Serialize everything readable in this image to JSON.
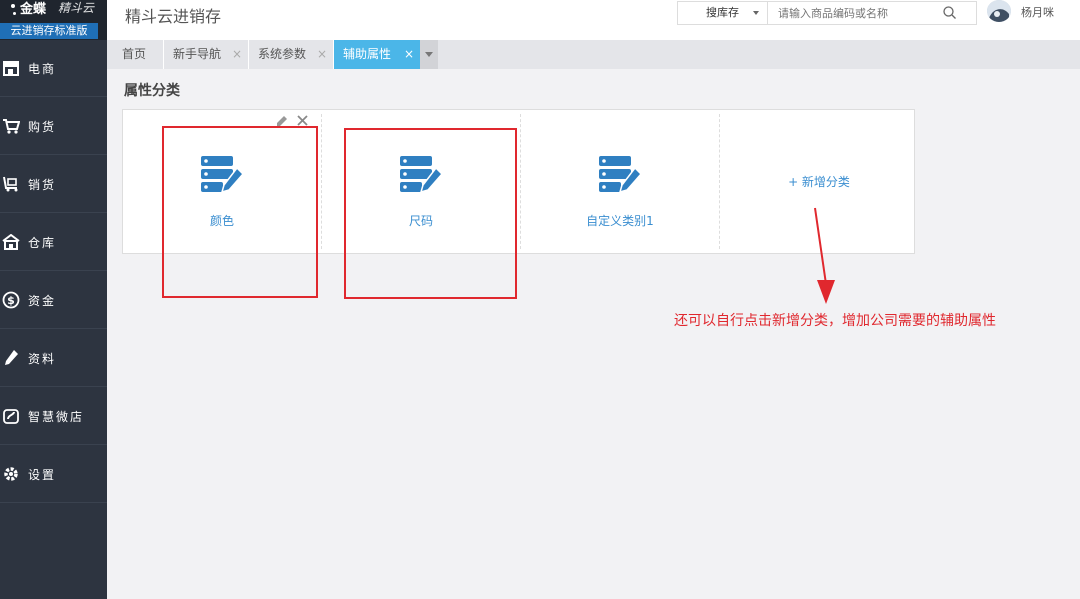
{
  "sidebar": {
    "brand": "金蝶",
    "brand_sub": "精斗云",
    "edition": "云进销存标准版",
    "items": [
      {
        "label": "电商",
        "icon": "store-icon"
      },
      {
        "label": "购货",
        "icon": "cart-icon"
      },
      {
        "label": "销货",
        "icon": "sales-cart-icon"
      },
      {
        "label": "仓库",
        "icon": "warehouse-icon"
      },
      {
        "label": "资金",
        "icon": "dollar-icon"
      },
      {
        "label": "资料",
        "icon": "pencil-icon"
      },
      {
        "label": "智慧微店",
        "icon": "shop-bag-icon"
      },
      {
        "label": "设置",
        "icon": "gear-icon"
      }
    ]
  },
  "header": {
    "title": "精斗云进销存",
    "search_scope": "搜库存",
    "search_placeholder": "请输入商品编码或名称",
    "user_name": "杨月咪"
  },
  "tabs": [
    {
      "label": "首页",
      "closable": false,
      "active": false
    },
    {
      "label": "新手导航",
      "closable": true,
      "active": false
    },
    {
      "label": "系统参数",
      "closable": true,
      "active": false
    },
    {
      "label": "辅助属性",
      "closable": true,
      "active": true
    }
  ],
  "tab_close_glyph": "×",
  "main": {
    "section_title": "属性分类",
    "categories": [
      {
        "label": "颜色"
      },
      {
        "label": "尺码"
      },
      {
        "label": "自定义类别1"
      }
    ],
    "add_category_label": "+ 新增分类"
  },
  "annotation": {
    "text": "还可以自行点击新增分类，增加公司需要的辅助属性",
    "color": "#e0282e"
  },
  "colors": {
    "sidebar_bg": "#2d3440",
    "active_tab": "#4bb6e8",
    "edition_bg": "#1f6fb6",
    "link_blue": "#3a8ed0"
  }
}
